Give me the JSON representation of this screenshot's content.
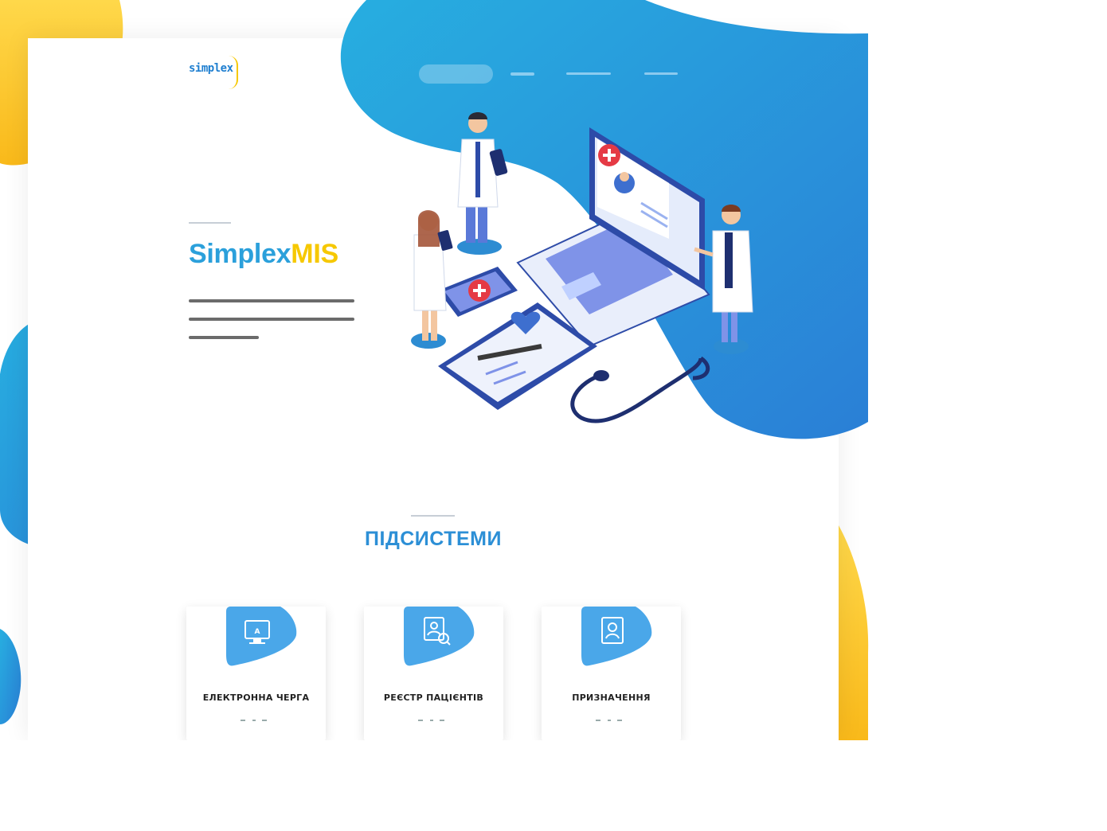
{
  "brand": {
    "logo_main": "simplex",
    "logo_tag": "",
    "logo_sub": "",
    "accent_blue": "#2ba0db",
    "accent_yellow": "#f6c800"
  },
  "nav": {
    "items": [
      {
        "label": ""
      },
      {
        "label": ""
      },
      {
        "label": ""
      },
      {
        "label": ""
      }
    ]
  },
  "hero": {
    "title_main": "Simplex",
    "title_accent": "MIS",
    "description": ""
  },
  "subsystems": {
    "title": "ПІДСИСТЕМИ",
    "cards": [
      {
        "title": "ЕЛЕКТРОННА ЧЕРГА",
        "icon": "monitor-icon"
      },
      {
        "title": "РЕЄСТР ПАЦІЄНТІВ",
        "icon": "patient-registry-icon"
      },
      {
        "title": "ПРИЗНАЧЕННЯ",
        "icon": "prescription-icon"
      }
    ]
  }
}
